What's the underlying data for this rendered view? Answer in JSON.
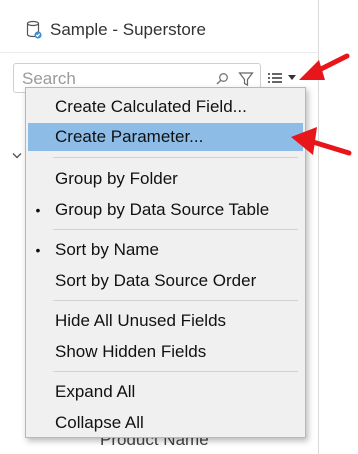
{
  "datasource": {
    "name": "Sample - Superstore",
    "icon": "datasource-cylinder-icon"
  },
  "search": {
    "placeholder": "Search",
    "value": ""
  },
  "toolbar": {
    "filter_icon": "filter-icon",
    "view_icon": "list-view-icon",
    "dropdown_icon": "chevron-down-icon"
  },
  "background_field": {
    "label": "Product Name"
  },
  "menu": {
    "groups": [
      {
        "items": [
          {
            "label": "Create Calculated Field...",
            "bullet": "",
            "highlighted": false
          },
          {
            "label": "Create Parameter...",
            "bullet": "",
            "highlighted": true
          }
        ]
      },
      {
        "items": [
          {
            "label": "Group by Folder",
            "bullet": "",
            "highlighted": false
          },
          {
            "label": "Group by Data Source Table",
            "bullet": "•",
            "highlighted": false
          }
        ]
      },
      {
        "items": [
          {
            "label": "Sort by Name",
            "bullet": "•",
            "highlighted": false
          },
          {
            "label": "Sort by Data Source Order",
            "bullet": "",
            "highlighted": false
          }
        ]
      },
      {
        "items": [
          {
            "label": "Hide All Unused Fields",
            "bullet": "",
            "highlighted": false
          },
          {
            "label": "Show Hidden Fields",
            "bullet": "",
            "highlighted": false
          }
        ]
      },
      {
        "items": [
          {
            "label": "Expand All",
            "bullet": "",
            "highlighted": false
          },
          {
            "label": "Collapse All",
            "bullet": "",
            "highlighted": false
          }
        ]
      }
    ]
  },
  "colors": {
    "highlight": "#8dbde6",
    "annotation_arrow": "#e8161b",
    "menu_background": "#f0f0f0"
  }
}
